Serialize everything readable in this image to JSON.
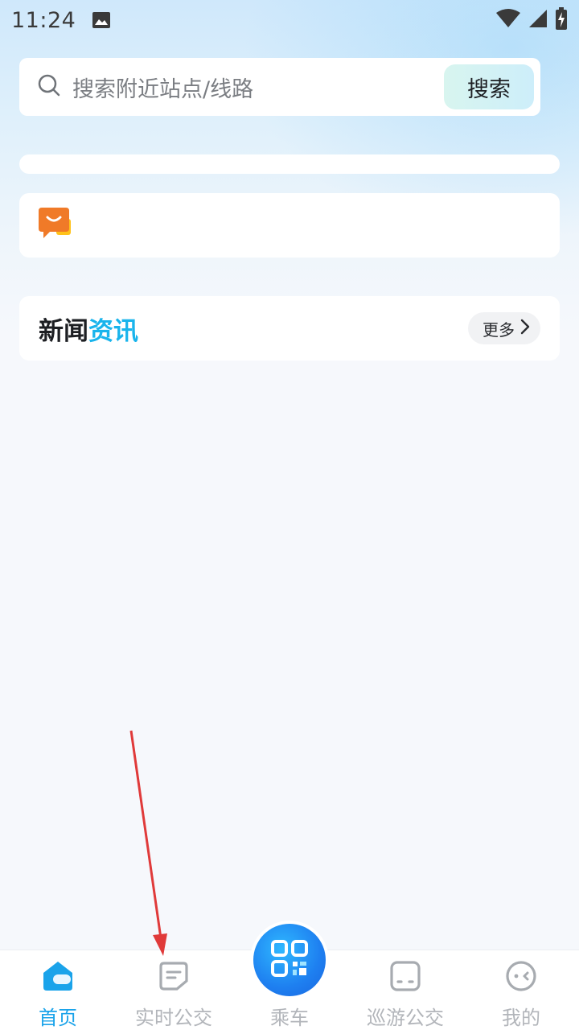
{
  "status_bar": {
    "time": "11:24"
  },
  "search": {
    "placeholder": "搜索附近站点/线路",
    "button_label": "搜索"
  },
  "news": {
    "title_main": "新闻",
    "title_accent": "资讯",
    "more_label": "更多"
  },
  "bottom_nav": {
    "items": [
      {
        "label": "首页",
        "icon": "home-icon",
        "active": true
      },
      {
        "label": "实时公交",
        "icon": "realtime-bus-icon",
        "active": false
      },
      {
        "label": "乘车",
        "icon": "qr-code-icon",
        "active": false
      },
      {
        "label": "巡游公交",
        "icon": "tour-bus-icon",
        "active": false
      },
      {
        "label": "我的",
        "icon": "profile-icon",
        "active": false
      }
    ]
  },
  "colors": {
    "accent": "#19b4ec",
    "nav_active": "#1aa3ea",
    "nav_inactive": "#b2b5ba",
    "notice_icon": "#f07a28",
    "annotation_arrow": "#e03a3a"
  }
}
